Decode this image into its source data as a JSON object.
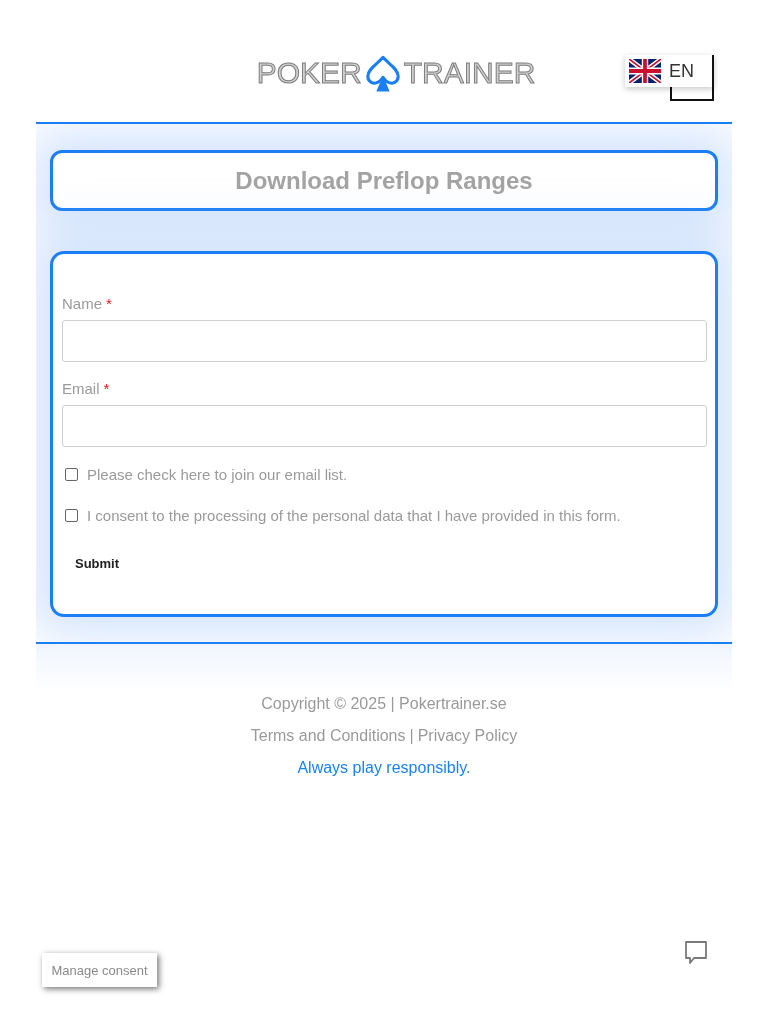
{
  "header": {
    "logo": {
      "left_text": "POKER",
      "right_text": "TRAINER"
    },
    "language": {
      "code": "EN"
    }
  },
  "title": "Download Preflop Ranges",
  "form": {
    "fields": [
      {
        "label": "Name",
        "required_mark": "*"
      },
      {
        "label": "Email",
        "required_mark": "*"
      }
    ],
    "checkboxes": [
      {
        "label": "Please check here to join our email list.",
        "checked": false
      },
      {
        "label": "I consent to the processing of the personal data that I have provided in this form.",
        "checked": false
      }
    ],
    "submit": "Submit"
  },
  "footer": {
    "copyright": "Copyright © 2025 | Pokertrainer.se",
    "links": [
      "Terms and Conditions",
      "Privacy Policy"
    ],
    "separator": "|",
    "tagline": "Always play responsibly."
  },
  "consent_button": "Manage consent"
}
